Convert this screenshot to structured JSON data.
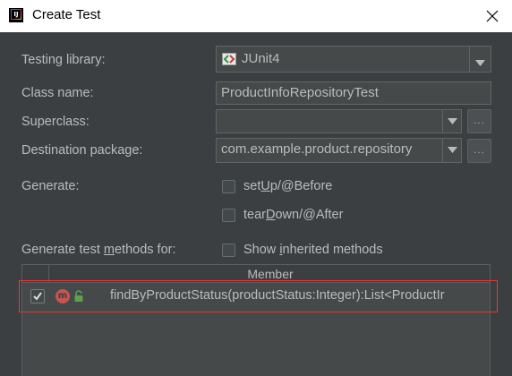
{
  "window": {
    "title": "Create Test",
    "app_icon": "intellij-icon",
    "app_icon_letters": "IJ",
    "close_icon": "close-icon"
  },
  "form": {
    "testing_library": {
      "label": "Testing library:",
      "value": "JUnit4",
      "icon": "junit-icon"
    },
    "class_name": {
      "label": "Class name:",
      "value": "ProductInfoRepositoryTest"
    },
    "superclass": {
      "label": "Superclass:",
      "value": "",
      "browse_label": "..."
    },
    "destination_package": {
      "label": "Destination package:",
      "value": "com.example.product.repository",
      "browse_label": "..."
    },
    "generate": {
      "label": "Generate:",
      "setup": {
        "pre": "set",
        "mnemonic": "U",
        "post": "p/@Before",
        "checked": false
      },
      "teardown": {
        "pre": "tear",
        "mnemonic": "D",
        "post": "own/@After",
        "checked": false
      }
    },
    "generate_methods": {
      "label_pre": "Generate test ",
      "label_mnemonic": "m",
      "label_post": "ethods for:",
      "show_inherited": {
        "pre": "Show ",
        "mnemonic": "i",
        "post": "nherited methods",
        "checked": false
      }
    }
  },
  "members_table": {
    "header": "Member",
    "rows": [
      {
        "checked": true,
        "icon": "method-icon",
        "icon_letter": "m",
        "visibility_icon": "public-lock-icon",
        "signature": "findByProductStatus(productStatus:Integer):List<ProductIr"
      }
    ]
  },
  "colors": {
    "background": "#3c3f41",
    "field": "#45494a",
    "text": "#bbbbbb",
    "highlight": "#e53935",
    "method_icon": "#c75450"
  }
}
